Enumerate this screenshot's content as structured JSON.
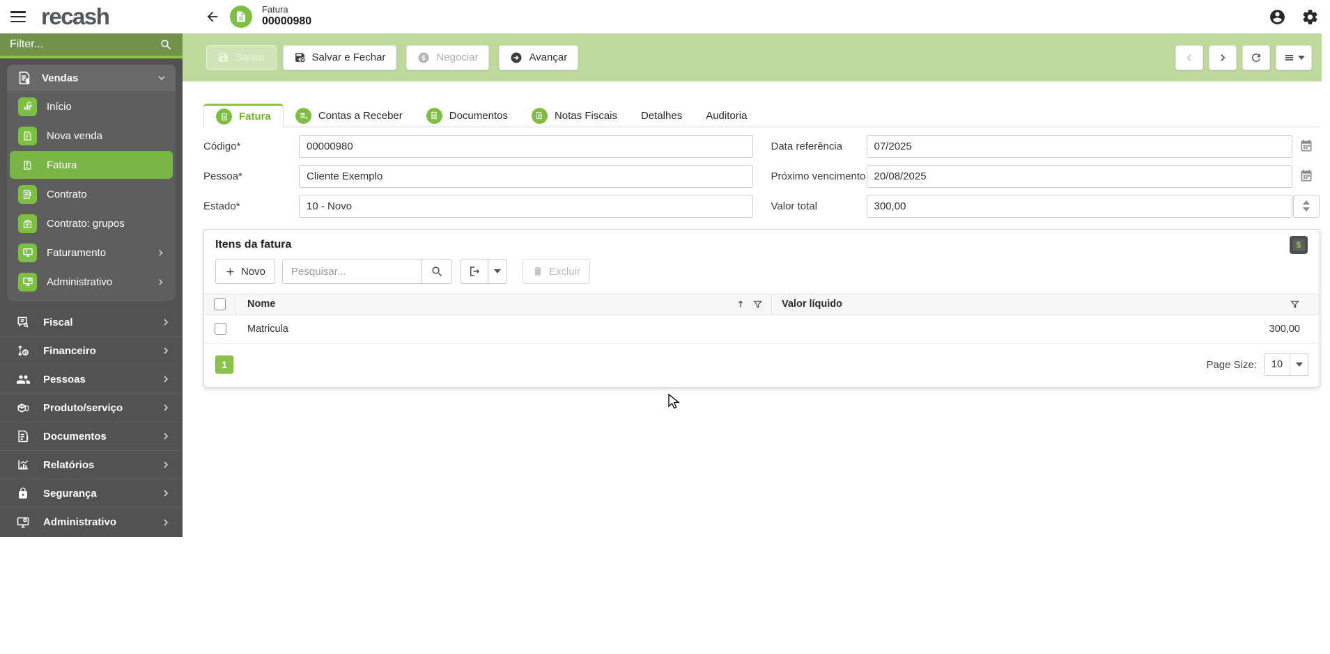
{
  "topbar": {
    "logo": "recash",
    "title": "Fatura",
    "subtitle": "00000980"
  },
  "toolbar": {
    "save": "Salvar",
    "save_close": "Salvar e Fechar",
    "negotiate": "Negociar",
    "advance": "Avançar"
  },
  "sidebar": {
    "filter_placeholder": "Filter...",
    "group": {
      "label": "Vendas",
      "items": [
        {
          "label": "Início"
        },
        {
          "label": "Nova venda"
        },
        {
          "label": "Fatura"
        },
        {
          "label": "Contrato"
        },
        {
          "label": "Contrato: grupos"
        },
        {
          "label": "Faturamento"
        },
        {
          "label": "Administrativo"
        }
      ]
    },
    "items": [
      {
        "label": "Fiscal"
      },
      {
        "label": "Financeiro"
      },
      {
        "label": "Pessoas"
      },
      {
        "label": "Produto/serviço"
      },
      {
        "label": "Documentos"
      },
      {
        "label": "Relatórios"
      },
      {
        "label": "Segurança"
      },
      {
        "label": "Administrativo"
      }
    ]
  },
  "tabs": [
    {
      "label": "Fatura"
    },
    {
      "label": "Contas a Receber"
    },
    {
      "label": "Documentos"
    },
    {
      "label": "Notas Fiscais"
    },
    {
      "label": "Detalhes"
    },
    {
      "label": "Auditoria"
    }
  ],
  "form": {
    "codigo": {
      "label": "Código*",
      "value": "00000980"
    },
    "pessoa": {
      "label": "Pessoa*",
      "value": "Cliente Exemplo"
    },
    "estado": {
      "label": "Estado*",
      "value": "10 - Novo"
    },
    "data_referencia": {
      "label": "Data referência",
      "value": "07/2025"
    },
    "proximo_vencimento": {
      "label": "Próximo vencimento",
      "value": "20/08/2025"
    },
    "valor_total": {
      "label": "Valor total",
      "value": "300,00"
    }
  },
  "items_panel": {
    "title": "Itens da fatura",
    "new_label": "Novo",
    "search_placeholder": "Pesquisar...",
    "delete_label": "Excluir",
    "columns": {
      "nome": "Nome",
      "valor": "Valor líquido"
    },
    "rows": [
      {
        "nome": "Matricula",
        "valor": "300,00"
      }
    ],
    "pagination": {
      "page": "1",
      "page_size_label": "Page Size:",
      "page_size": "10"
    }
  },
  "colors": {
    "brand_green": "#7cbf42",
    "accent_green": "#8cc63e",
    "active_green": "#79b544",
    "toolbar_band": "#bdda9c",
    "filter_bar": "#70924d",
    "sidebar_bg": "#525252"
  }
}
